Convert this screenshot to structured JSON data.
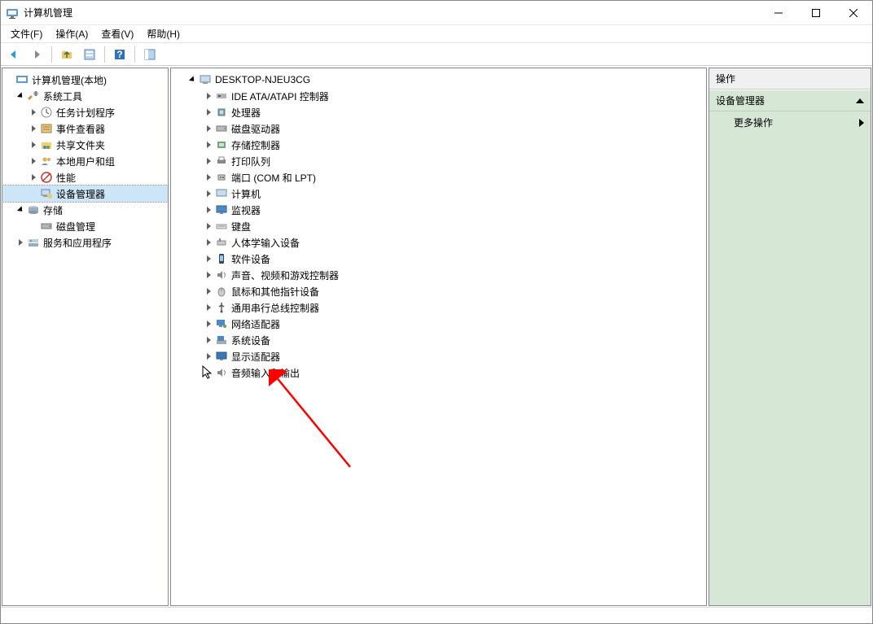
{
  "titlebar": {
    "title": "计算机管理"
  },
  "menu": {
    "items": [
      "文件(F)",
      "操作(A)",
      "查看(V)",
      "帮助(H)"
    ]
  },
  "leftTree": {
    "root": {
      "label": "计算机管理(本地)"
    },
    "groups": [
      {
        "label": "系统工具",
        "children": [
          {
            "label": "任务计划程序"
          },
          {
            "label": "事件查看器"
          },
          {
            "label": "共享文件夹"
          },
          {
            "label": "本地用户和组"
          },
          {
            "label": "性能"
          },
          {
            "label": "设备管理器",
            "selected": true
          }
        ]
      },
      {
        "label": "存储",
        "children": [
          {
            "label": "磁盘管理"
          }
        ]
      },
      {
        "label": "服务和应用程序"
      }
    ]
  },
  "centerTree": {
    "root": {
      "label": "DESKTOP-NJEU3CG"
    },
    "children": [
      {
        "label": "IDE ATA/ATAPI 控制器"
      },
      {
        "label": "处理器"
      },
      {
        "label": "磁盘驱动器"
      },
      {
        "label": "存储控制器"
      },
      {
        "label": "打印队列"
      },
      {
        "label": "端口 (COM 和 LPT)"
      },
      {
        "label": "计算机"
      },
      {
        "label": "监视器"
      },
      {
        "label": "键盘"
      },
      {
        "label": "人体学输入设备"
      },
      {
        "label": "软件设备"
      },
      {
        "label": "声音、视频和游戏控制器"
      },
      {
        "label": "鼠标和其他指针设备"
      },
      {
        "label": "通用串行总线控制器"
      },
      {
        "label": "网络适配器"
      },
      {
        "label": "系统设备"
      },
      {
        "label": "显示适配器"
      },
      {
        "label": "音频输入和输出"
      }
    ]
  },
  "rightPanel": {
    "header": "操作",
    "section": "设备管理器",
    "item": "更多操作"
  }
}
